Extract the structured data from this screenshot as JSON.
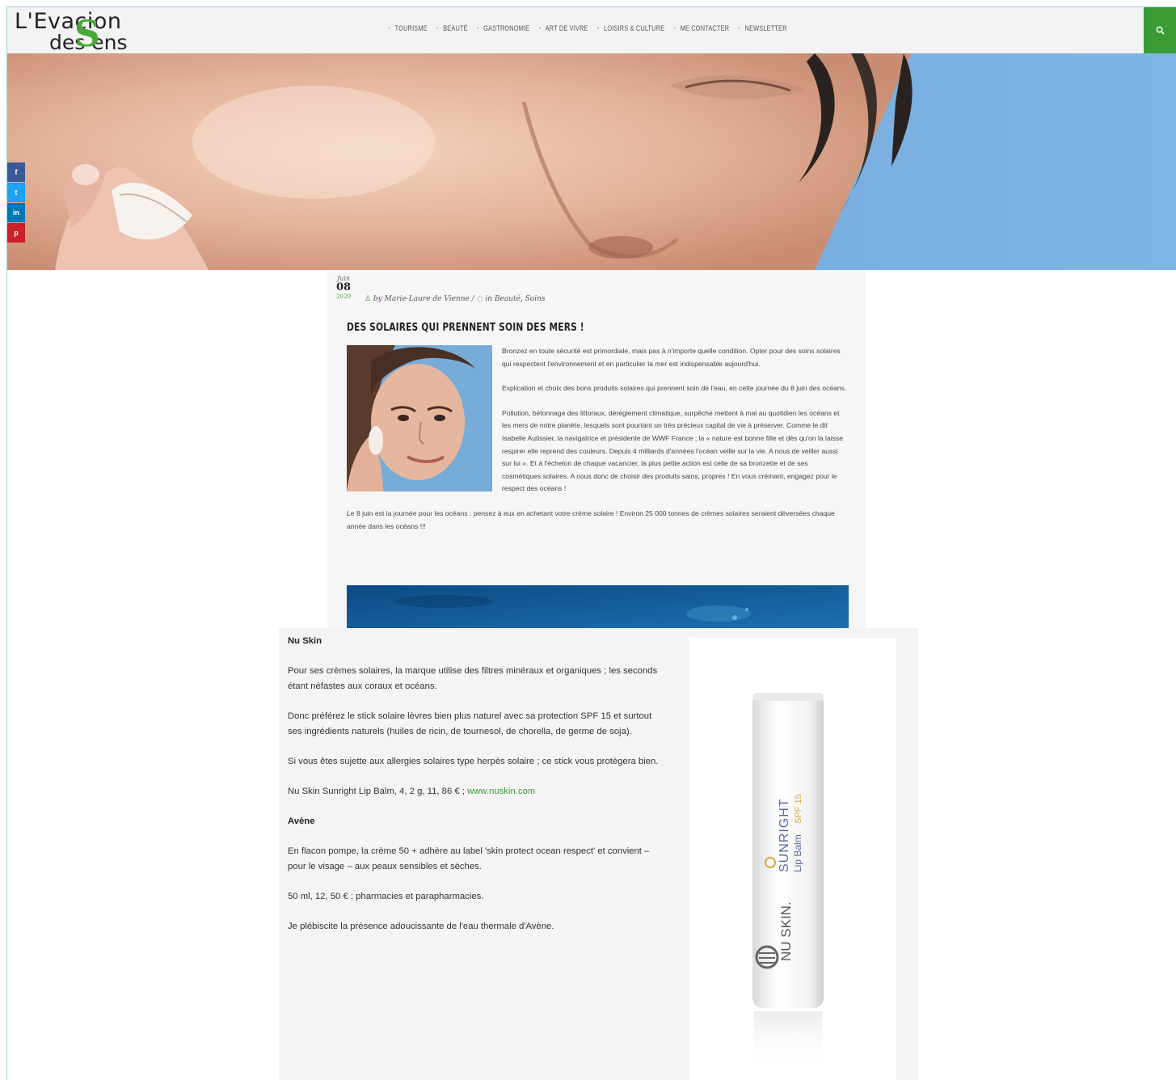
{
  "header": {
    "logo_line1": "L'Evacion",
    "logo_line2": "des ens",
    "logo_s": "S",
    "nav": [
      "TOURISME",
      "BEAUTÉ",
      "GASTRONOMIE",
      "ART DE VIVRE",
      "LOISIRS & CULTURE",
      "ME CONTACTER",
      "NEWSLETTER"
    ],
    "search_icon": "search-icon"
  },
  "share": [
    "f",
    "t",
    "in",
    "p"
  ],
  "post": {
    "date_month": "Juin",
    "date_day": "08",
    "date_year": "2020",
    "author": "by Marie-Laure de Vienne /",
    "categories": "in Beauté, Soins",
    "title": "DES SOLAIRES QUI PRENNENT SOIN DES MERS !",
    "paragraphs": [
      "Bronzez en toute sécurité est primordiale, mais pas à n'importe quelle condition. Opter pour des soins solaires qui respectent l'environnement et en particulier la mer est indispensable aujourd'hui.",
      "Explication et choix des bons produits solaires qui prennent soin de l'eau, en cette journée du 8 juin des océans.",
      "Pollution, bétonnage des littoraux, dérèglement climatique, surpêche mettent à mal au quotidien les océans et les mers de notre planète, lesquels sont pourtant un très précieux capital de vie à préserver. Comme le dit Isabelle Autissier, la navigatrice et présidente de WWF France ; la « nature est bonne fille et dès qu'on la laisse respirer elle reprend des couleurs. Depuis 4 milliards d'années l'océan veille sur la vie. A nous de veiller aussi sur lui ». Et à l'échelon de chaque vacancier, la plus petite action est celle de sa bronzette et de ses cosmétiques solaires. A nous donc de choisir des produits sains, propres ! En vous crémant, engagez pour le respect des océans !",
      "Le 8 juin est la journée pour les océans : pensez à eux en achetant votre crème solaire ! Environ 25 000 tonnes de crèmes solaires seraient déversées chaque année dans les océans !!!"
    ]
  },
  "lower": {
    "nuskin_heading": "Nu Skin",
    "p1": "Pour ses crèmes solaires, la marque utilise des filtres minéraux et organiques ; les seconds étant néfastes aux coraux et océans.",
    "p2": "Donc préférez le stick solaire lèvres bien plus naturel avec sa protection SPF 15 et surtout ses ingrédients naturels (huiles de ricin, de tournesol, de chorella, de germe de soja).",
    "p3": "Si vous êtes sujette aux allergies solaires type herpès solaire ; ce stick vous protègera bien.",
    "p4_text": "Nu Skin Sunright Lip Balm, 4, 2 g, 11, 86 € ; ",
    "p4_link": "www.nuskin.com",
    "avene_heading": "Avène",
    "p5": "En flacon pompe, la crème 50 + adhère au label 'skin protect ocean respect' et convient – pour le visage – aux peaux sensibles et sèches.",
    "p6": "50 ml, 12, 50 € ; pharmacies et parapharmacies.",
    "p7": "Je plébiscite la présence adoucissante de l'eau thermale d'Avène."
  },
  "product": {
    "brand": "NU SKIN.",
    "name": "SUNRIGHT",
    "sub": "Lip Balm",
    "spf": "SPF 15"
  },
  "colors": {
    "accent": "#3a9b35",
    "facebook": "#3b5998",
    "twitter": "#1da1f2",
    "linkedin": "#0077b5",
    "pinterest": "#cb2027",
    "sky": "#74a9dc"
  }
}
